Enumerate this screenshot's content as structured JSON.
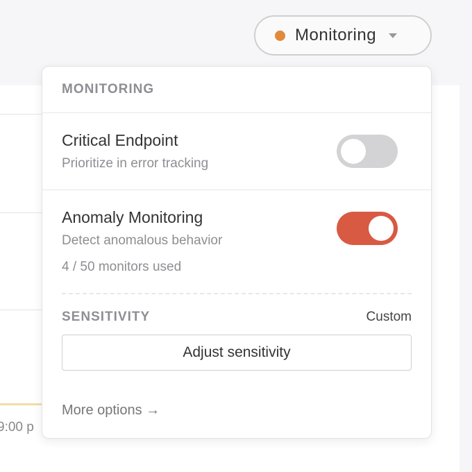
{
  "background": {
    "time_label": "9:00 p"
  },
  "status_button": {
    "label": "Monitoring",
    "dot_color": "#e08a3c",
    "icon": "chevron-down-icon"
  },
  "dropdown": {
    "heading": "MONITORING",
    "critical_endpoint": {
      "title": "Critical Endpoint",
      "description": "Prioritize in error tracking",
      "enabled": false
    },
    "anomaly_monitoring": {
      "title": "Anomaly Monitoring",
      "description": "Detect anomalous behavior",
      "usage": "4 / 50 monitors used",
      "enabled": true,
      "toggle_color": "#d85a43"
    },
    "sensitivity": {
      "heading": "SENSITIVITY",
      "value": "Custom",
      "button_label": "Adjust sensitivity"
    },
    "more_options": "More options →"
  }
}
